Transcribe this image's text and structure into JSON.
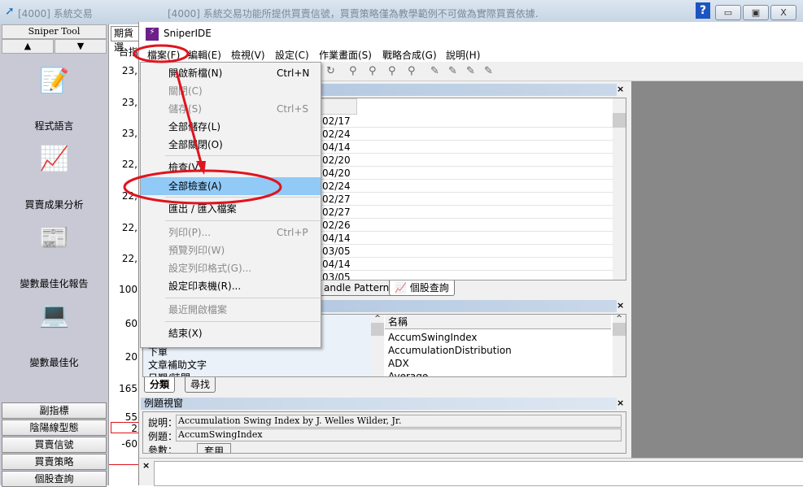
{
  "outer": {
    "title": "[4000] 系統交易",
    "notice": "[4000] 系統交易功能所提供買賣信號，買賣策略僅為教學範例不可做為實際買賣依據.",
    "help": "?",
    "min": "▭",
    "max": "▣",
    "close": "X"
  },
  "sidebar": {
    "header": "Sniper Tool",
    "up": "▲",
    "down": "▼",
    "tools": [
      {
        "label": "程式語言",
        "icon": "📝"
      },
      {
        "label": "買賣成果分析",
        "icon": "📈"
      },
      {
        "label": "變數最佳化報告",
        "icon": "📰"
      },
      {
        "label": "變數最佳化",
        "icon": "💻"
      }
    ],
    "buttons": [
      "副指標",
      "陰陽線型態",
      "買賣信號",
      "買賣策略",
      "個股查詢"
    ]
  },
  "background": {
    "tab": "期貨選",
    "subtab": "台指",
    "numbers": [
      "23,",
      "23,",
      "23,",
      "22,",
      "22,",
      "22,",
      "22,",
      "100",
      "60",
      "20",
      "165",
      "55",
      "2",
      "-60"
    ]
  },
  "ide": {
    "title": "SniperIDE",
    "menu": [
      "檔案(F)",
      "編輯(E)",
      "檢視(V)",
      "設定(C)",
      "作業畫面(S)",
      "戰略合成(G)",
      "說明(H)"
    ],
    "file_menu": [
      {
        "label": "開啟新檔(N)",
        "shortcut": "Ctrl+N",
        "enabled": true
      },
      {
        "label": "關閉(C)",
        "enabled": false
      },
      {
        "label": "儲存(S)",
        "shortcut": "Ctrl+S",
        "enabled": false
      },
      {
        "label": "全部儲存(L)",
        "enabled": true
      },
      {
        "label": "全部關閉(O)",
        "enabled": true
      },
      {
        "label": "檢查(V)",
        "enabled": true
      },
      {
        "label": "全部檢查(A)",
        "enabled": true,
        "highlighted": true
      },
      {
        "label": "匯出 / 匯入檔案",
        "enabled": true
      },
      {
        "label": "列印(P)...",
        "shortcut": "Ctrl+P",
        "enabled": false
      },
      {
        "label": "預覽列印(W)",
        "enabled": false
      },
      {
        "label": "設定列印格式(G)...",
        "enabled": false
      },
      {
        "label": "設定印表機(R)...",
        "enabled": true
      },
      {
        "label": "最近開啟檔案",
        "enabled": false
      },
      {
        "label": "結束(X)",
        "enabled": true
      }
    ],
    "dates": [
      "02/17",
      "02/24",
      "04/14",
      "02/20",
      "04/20",
      "02/24",
      "02/27",
      "02/27",
      "02/26",
      "04/14",
      "03/05",
      "04/14",
      "03/05"
    ],
    "upper_tabs": [
      "andle Pattern",
      "個股查詢"
    ],
    "categories": [
      "下單",
      "文章補助文字",
      "日期/時間"
    ],
    "name_header": "名稱",
    "names": [
      "AccumSwingIndex",
      "AccumulationDistribution",
      "ADX",
      "Average"
    ],
    "lower_tabs": [
      "分類",
      "尋找"
    ],
    "example": {
      "caption": "例題視窗",
      "desc_label": "說明：",
      "desc": "Accumulation Swing Index by J. Welles Wilder, Jr.",
      "example_label": "例題：",
      "example": "AccumSwingIndex",
      "param_label": "參數：",
      "apply": "套用"
    },
    "close_x": "×"
  },
  "colors": {
    "annotation": "#e0141e",
    "highlight": "#91c9f7",
    "caption": "#b7cbe3"
  }
}
